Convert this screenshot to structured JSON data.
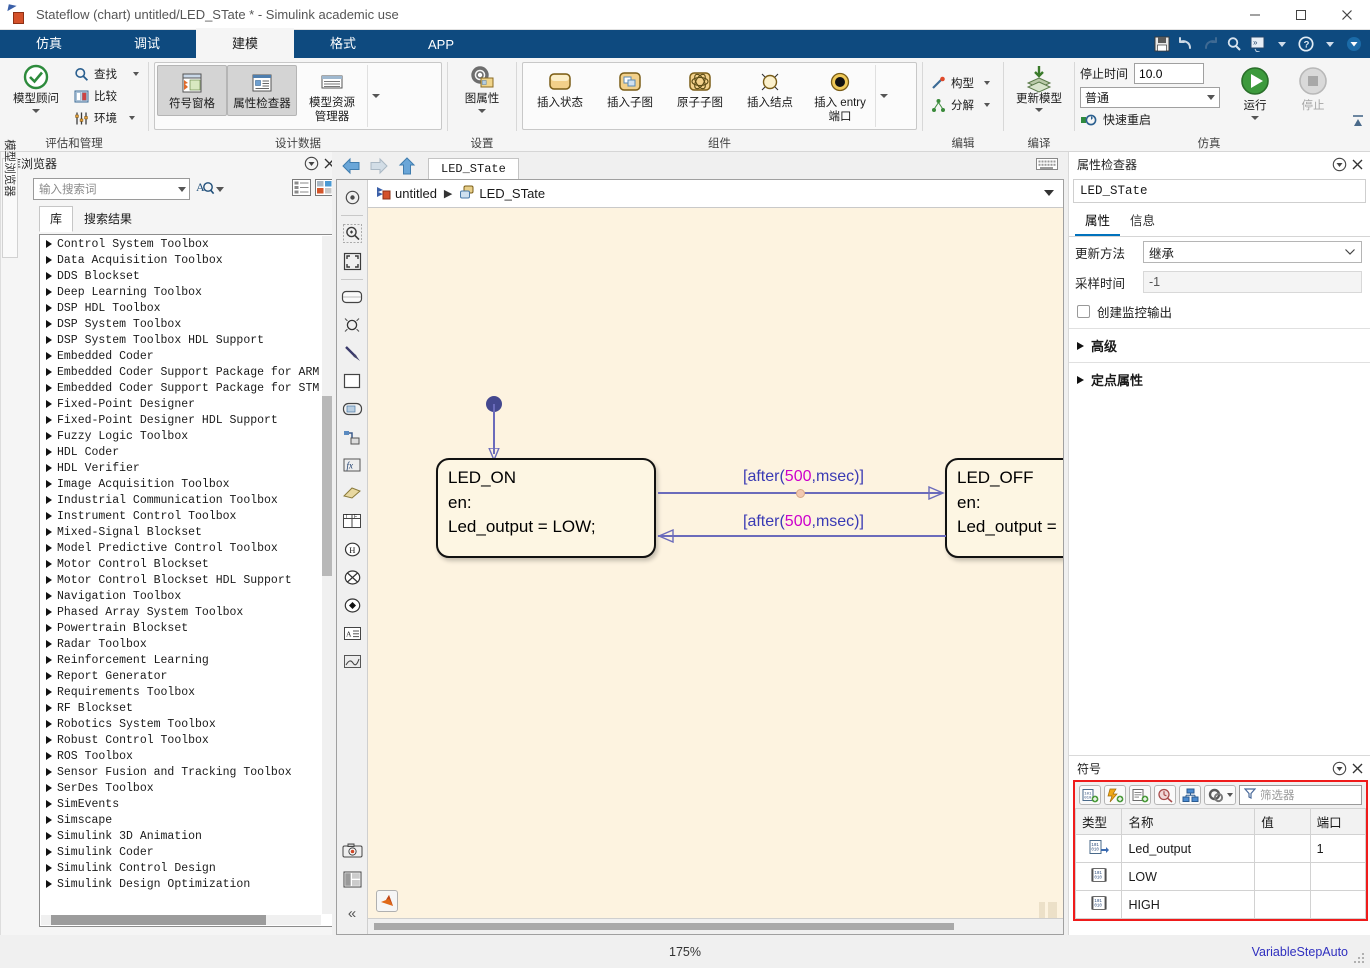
{
  "window": {
    "title": "Stateflow (chart) untitled/LED_STate * - Simulink academic use",
    "minimize": "─",
    "maximize": "□",
    "close": "✕"
  },
  "ribbon": {
    "tabs": [
      {
        "label": "仿真",
        "active": false
      },
      {
        "label": "调试",
        "active": false
      },
      {
        "label": "建模",
        "active": true
      },
      {
        "label": "格式",
        "active": false
      },
      {
        "label": "APP",
        "active": false
      }
    ],
    "quick_access": [
      "save-icon",
      "undo-icon",
      "redo-icon",
      "search-icon",
      "shortcuts-icon",
      "chevron-down-icon",
      "help-icon",
      "chevron-down-icon",
      "minimize-ribbon-icon"
    ],
    "groups": [
      {
        "label": "评估和管理",
        "big_button": "模型顾问",
        "small_buttons": [
          "查找",
          "比较",
          "环境"
        ]
      },
      {
        "label": "设计数据",
        "buttons": [
          "符号窗格",
          "属性检查器",
          "模型资源\n管理器"
        ]
      },
      {
        "label": "设置",
        "big_button": "图属性"
      },
      {
        "label": "组件",
        "buttons": [
          "插入状态",
          "插入子图",
          "原子子图",
          "插入结点",
          "插入 entry\n端口"
        ]
      },
      {
        "label": "编辑",
        "small_buttons": [
          "构型",
          "分解"
        ]
      },
      {
        "label": "编译",
        "big_button": "更新模型"
      },
      {
        "label": "仿真",
        "stop_time_label": "停止时间",
        "stop_time_value": "10.0",
        "mode_value": "普通",
        "fast_restart": "快速重启",
        "run_label": "运行",
        "stop_label": "停止"
      }
    ]
  },
  "library": {
    "vertical_tab": "模型浏览器",
    "title": "库浏览器",
    "search_placeholder": "输入搜索词",
    "tabs": [
      {
        "label": "库",
        "active": true
      },
      {
        "label": "搜索结果",
        "active": false
      }
    ],
    "items": [
      "Control System Toolbox",
      "Data Acquisition Toolbox",
      "DDS Blockset",
      "Deep Learning Toolbox",
      "DSP HDL Toolbox",
      "DSP System Toolbox",
      "DSP System Toolbox HDL Support",
      "Embedded Coder",
      "Embedded Coder Support Package for ARM..",
      "Embedded Coder Support Package for STM..",
      "Fixed-Point Designer",
      "Fixed-Point Designer HDL Support",
      "Fuzzy Logic Toolbox",
      "HDL Coder",
      "HDL Verifier",
      "Image Acquisition Toolbox",
      "Industrial Communication Toolbox",
      "Instrument Control Toolbox",
      "Mixed-Signal Blockset",
      "Model Predictive Control Toolbox",
      "Motor Control Blockset",
      "Motor Control Blockset HDL Support",
      "Navigation Toolbox",
      "Phased Array System Toolbox",
      "Powertrain Blockset",
      "Radar Toolbox",
      "Reinforcement Learning",
      "Report Generator",
      "Requirements Toolbox",
      "RF Blockset",
      "Robotics System Toolbox",
      "Robust Control Toolbox",
      "ROS Toolbox",
      "Sensor Fusion and Tracking Toolbox",
      "SerDes Toolbox",
      "SimEvents",
      "Simscape",
      "Simulink 3D Animation",
      "Simulink Coder",
      "Simulink Control Design",
      "Simulink Design Optimization"
    ]
  },
  "editor": {
    "tab_label": "LED_STate",
    "breadcrumb": {
      "root": "untitled",
      "separator": "▶",
      "leaf": "LED_STate"
    },
    "chart": {
      "states": [
        {
          "name": "LED_ON",
          "lines": [
            "en:",
            "Led_output = LOW;"
          ]
        },
        {
          "name": "LED_OFF",
          "lines": [
            "en:",
            "Led_output ="
          ]
        }
      ],
      "transitions": [
        {
          "label_prefix": "[after(",
          "label_num": "500",
          "label_suffix": ",msec)]"
        },
        {
          "label_prefix": "[after(",
          "label_num": "500",
          "label_suffix": ",msec)]"
        }
      ]
    }
  },
  "inspector": {
    "title": "属性检查器",
    "object_name": "LED_STate",
    "tabs": [
      {
        "label": "属性",
        "active": true
      },
      {
        "label": "信息",
        "active": false
      }
    ],
    "fields": [
      {
        "label": "更新方法",
        "value": "继承",
        "type": "select"
      },
      {
        "label": "采样时间",
        "value": "-1",
        "type": "input"
      }
    ],
    "checkbox": {
      "label": "创建监控输出",
      "checked": false
    },
    "accordions": [
      "高级",
      "定点属性"
    ]
  },
  "symbols": {
    "title": "符号",
    "filter_placeholder": "筛选器",
    "toolbar_icons": [
      "add-data-icon",
      "add-event-icon",
      "add-message-icon",
      "resolve-icon",
      "tree-view-icon",
      "settings-icon",
      "chevron-down-icon"
    ],
    "columns": [
      "类型",
      "名称",
      "值",
      "端口"
    ],
    "rows": [
      {
        "type_icon": "output-data-icon",
        "name": "Led_output",
        "value": "",
        "port": "1"
      },
      {
        "type_icon": "constant-data-icon",
        "name": "LOW",
        "value": "",
        "port": ""
      },
      {
        "type_icon": "constant-data-icon",
        "name": "HIGH",
        "value": "",
        "port": ""
      }
    ]
  },
  "status": {
    "zoom": "175%",
    "solver": "VariableStepAuto"
  },
  "colors": {
    "ribbon_blue": "#0e4a7f",
    "canvas_bg": "#fdf3e0",
    "state_fill": "#fdf6e3",
    "transition": "#6b6bbb",
    "transition_text": "#3a3ab4",
    "number_magenta": "#cc00cc",
    "symbols_highlight": "#ef1b1b",
    "solver_text": "#2f2fbf"
  }
}
